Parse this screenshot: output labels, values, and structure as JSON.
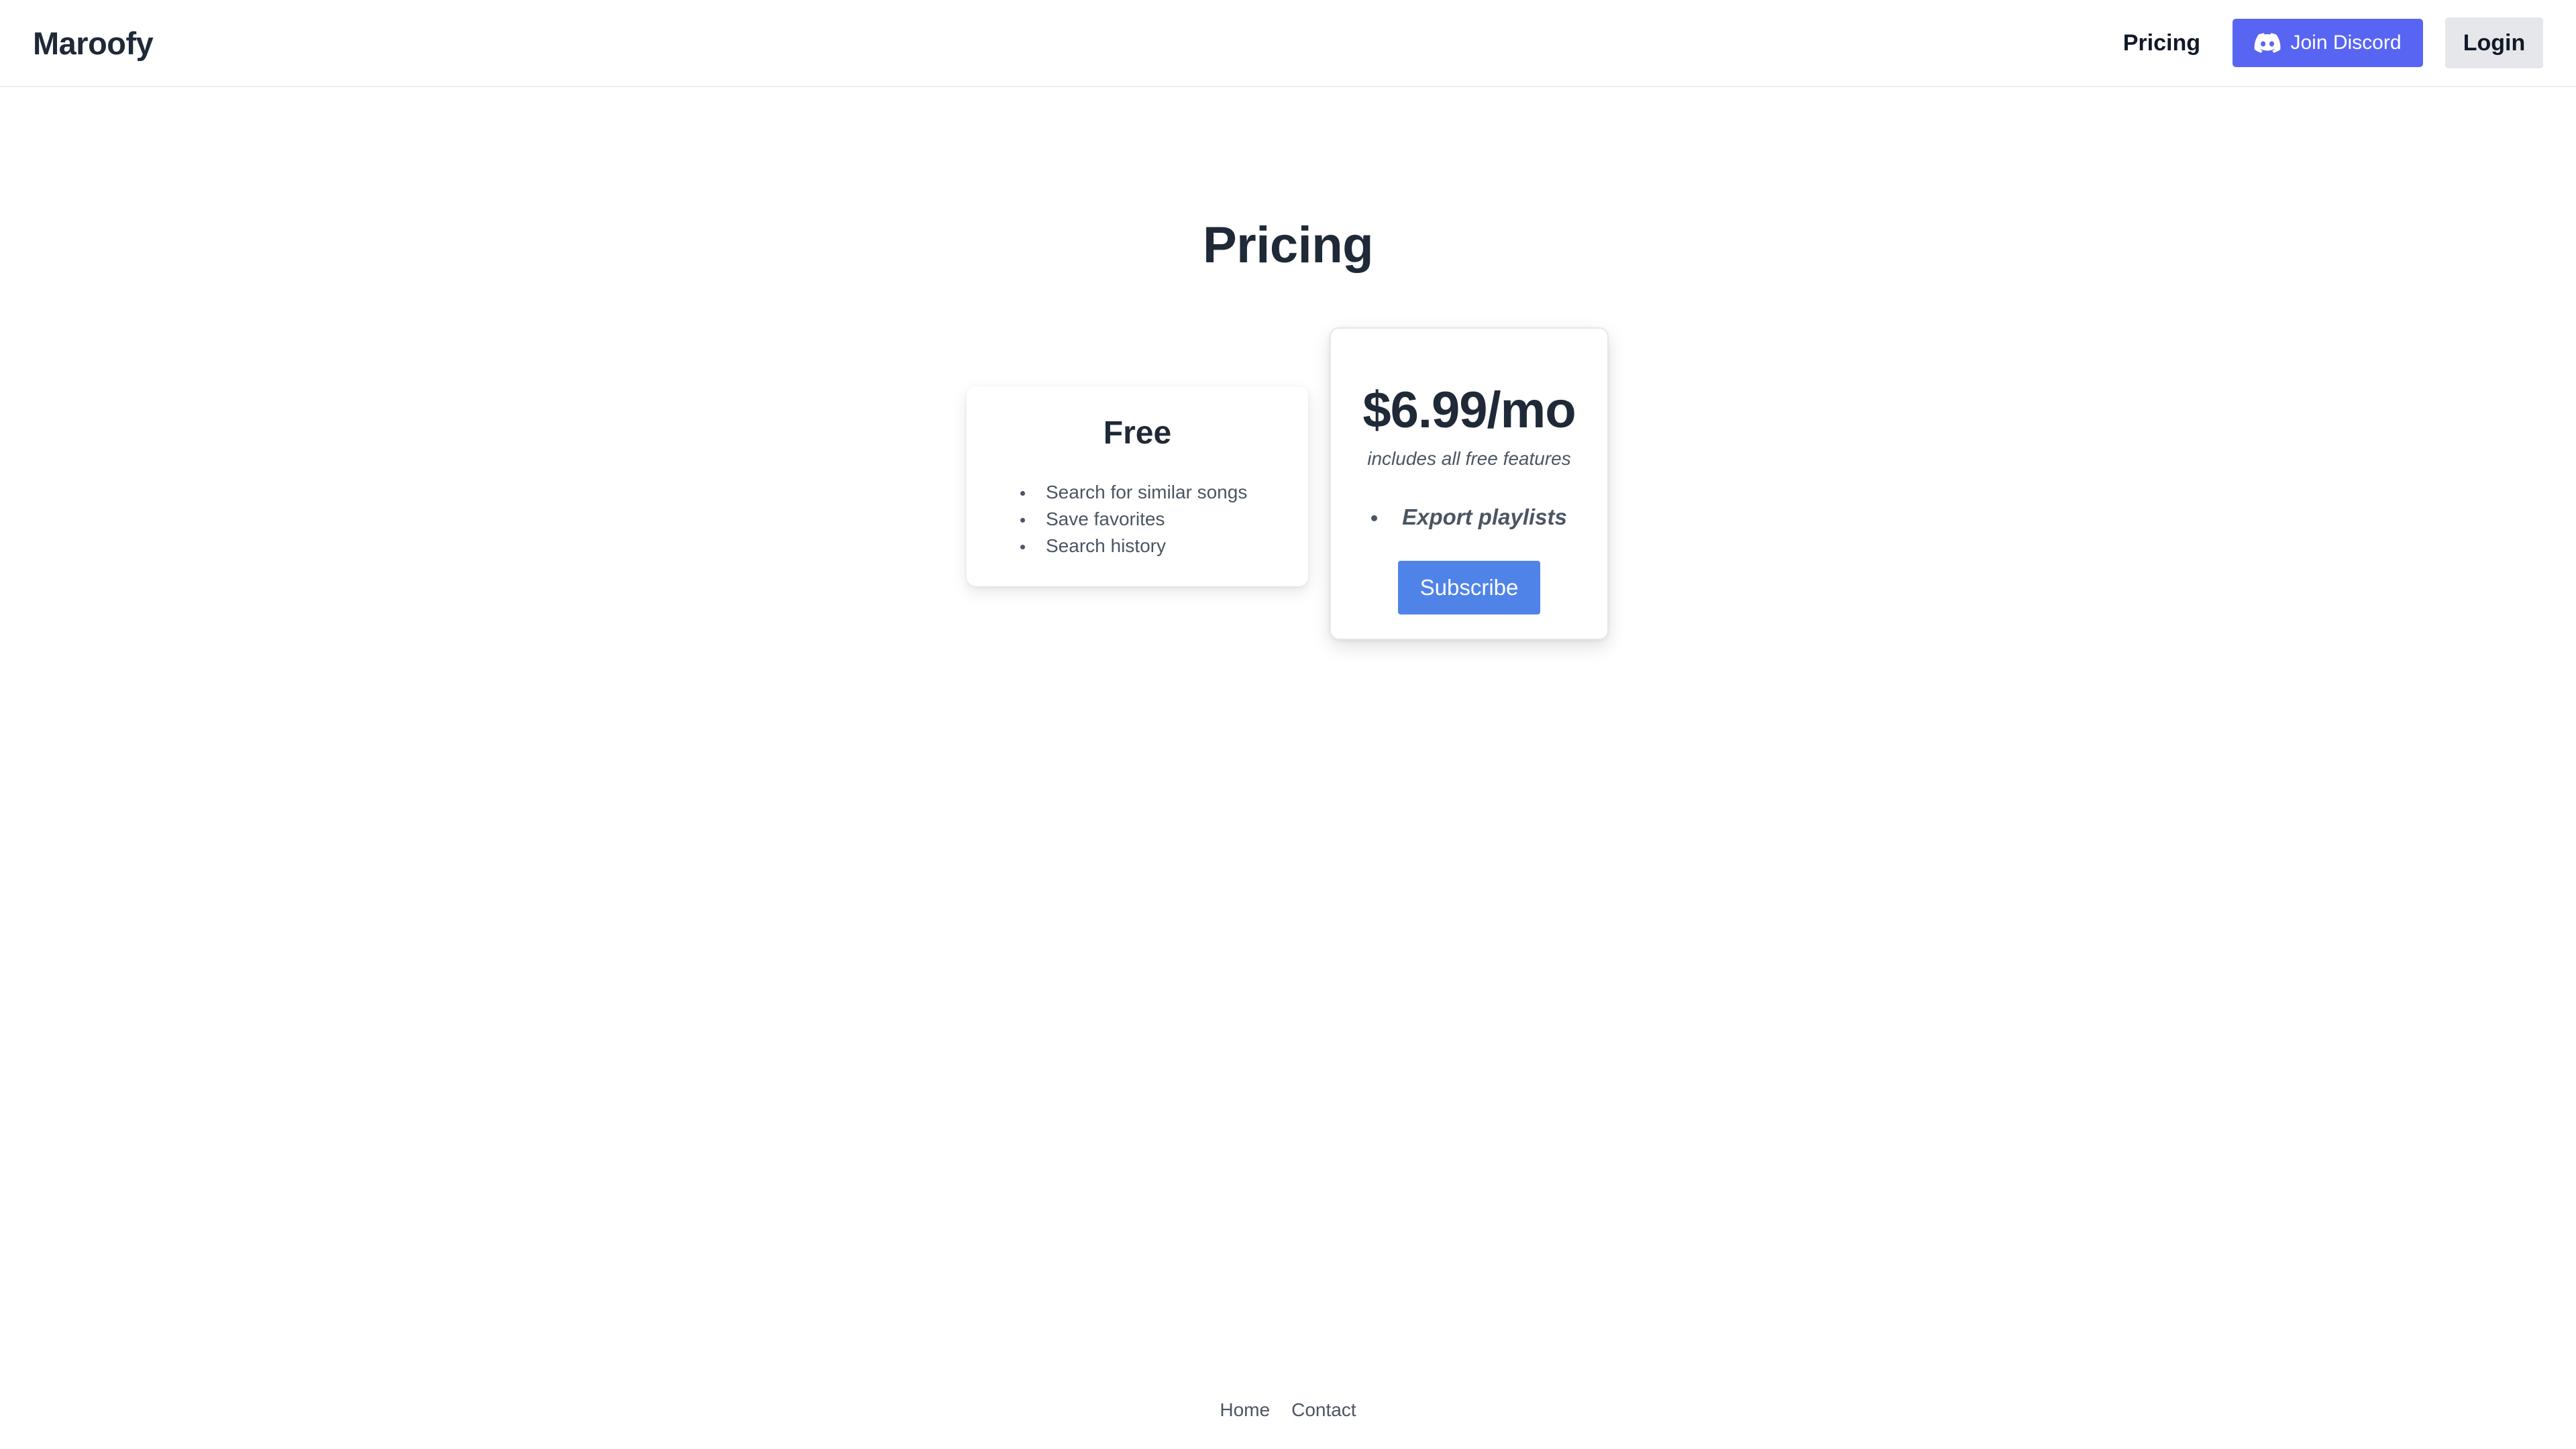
{
  "header": {
    "brand": "Maroofy",
    "nav_pricing": "Pricing",
    "discord_label": "Join Discord",
    "discord_icon": "discord-icon",
    "login_label": "Login"
  },
  "main": {
    "title": "Pricing",
    "free_plan": {
      "title": "Free",
      "features": [
        "Search for similar songs",
        "Save favorites",
        "Search history"
      ]
    },
    "pro_plan": {
      "price": "$6.99/mo",
      "subtitle": "includes all free features",
      "features": [
        "Export playlists"
      ],
      "cta": "Subscribe"
    }
  },
  "footer": {
    "links": [
      "Home",
      "Contact"
    ]
  },
  "colors": {
    "discord": "#5865f2",
    "subscribe": "#4f83e8",
    "login_bg": "#e5e7eb",
    "text_dark": "#1f2937",
    "text_muted": "#4b5563"
  }
}
